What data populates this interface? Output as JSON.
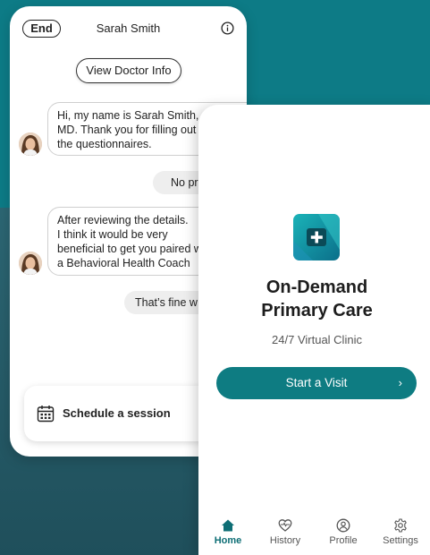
{
  "chat": {
    "end_label": "End",
    "title": "Sarah Smith",
    "view_doctor_label": "View Doctor Info",
    "messages": [
      {
        "from": "doctor",
        "lines": [
          "Hi, my name is Sarah Smith,",
          "MD. Thank you for filling out",
          "the questionnaires."
        ]
      },
      {
        "from": "user",
        "text": "No pr"
      },
      {
        "from": "doctor",
        "lines": [
          "After reviewing the details.",
          "I think it would be very",
          "beneficial to get you paired w",
          "a Behavioral Health Coach"
        ]
      },
      {
        "from": "user",
        "text": "That’s fine w"
      }
    ],
    "schedule_label": "Schedule a session"
  },
  "home": {
    "title_line1": "On-Demand",
    "title_line2": "Primary Care",
    "subtitle": "24/7 Virtual Clinic",
    "start_label": "Start a Visit",
    "start_chevron": "›",
    "tabs": [
      {
        "label": "Home",
        "icon": "home-icon",
        "active": true
      },
      {
        "label": "History",
        "icon": "history-heart-icon",
        "active": false
      },
      {
        "label": "Profile",
        "icon": "profile-icon",
        "active": false
      },
      {
        "label": "Settings",
        "icon": "gear-icon",
        "active": false
      }
    ]
  },
  "colors": {
    "background_top": "#0d7b86",
    "background_bottom": "#2c6673",
    "accent": "#0e7c82"
  }
}
